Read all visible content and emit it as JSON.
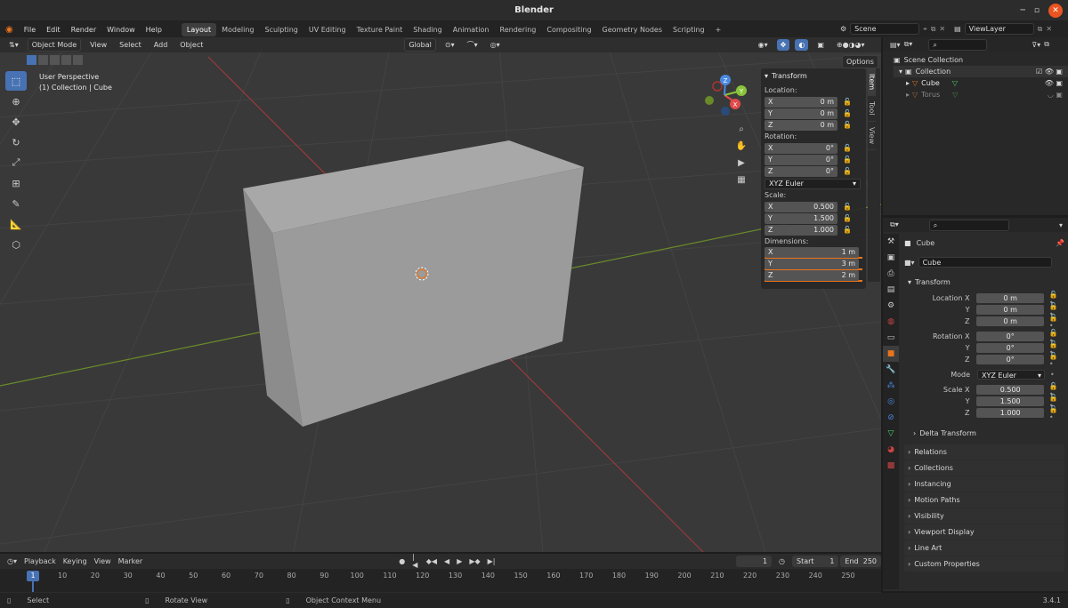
{
  "window": {
    "title": "Blender"
  },
  "topbar": {
    "menus": [
      "File",
      "Edit",
      "Render",
      "Window",
      "Help"
    ],
    "workspaces": [
      "Layout",
      "Modeling",
      "Sculpting",
      "UV Editing",
      "Texture Paint",
      "Shading",
      "Animation",
      "Rendering",
      "Compositing",
      "Geometry Nodes",
      "Scripting"
    ],
    "active_workspace": "Layout",
    "add_tab": "+",
    "scene": "Scene",
    "view_layer": "ViewLayer"
  },
  "viewport": {
    "mode": "Object Mode",
    "menus": [
      "View",
      "Select",
      "Add",
      "Object"
    ],
    "transform_orientation": "Global",
    "options_label": "Options",
    "overlay_title": "User Perspective",
    "overlay_subtitle": "(1) Collection | Cube",
    "gizmo_axes": [
      "X",
      "Y",
      "Z"
    ]
  },
  "npanel": {
    "title": "Transform",
    "location_label": "Location:",
    "location": [
      {
        "axis": "X",
        "value": "0 m"
      },
      {
        "axis": "Y",
        "value": "0 m"
      },
      {
        "axis": "Z",
        "value": "0 m"
      }
    ],
    "rotation_label": "Rotation:",
    "rotation": [
      {
        "axis": "X",
        "value": "0°"
      },
      {
        "axis": "Y",
        "value": "0°"
      },
      {
        "axis": "Z",
        "value": "0°"
      }
    ],
    "rotation_mode": "XYZ Euler",
    "scale_label": "Scale:",
    "scale": [
      {
        "axis": "X",
        "value": "0.500"
      },
      {
        "axis": "Y",
        "value": "1.500"
      },
      {
        "axis": "Z",
        "value": "1.000"
      }
    ],
    "dimensions_label": "Dimensions:",
    "dimensions": [
      {
        "axis": "X",
        "value": "1 m"
      },
      {
        "axis": "Y",
        "value": "3 m"
      },
      {
        "axis": "Z",
        "value": "2 m"
      }
    ],
    "tabs": [
      "Item",
      "Tool",
      "View"
    ],
    "highlight_color": "#e8741c"
  },
  "outliner": {
    "root": "Scene Collection",
    "collection": "Collection",
    "items": [
      "Cube",
      "Torus"
    ]
  },
  "properties": {
    "object_name": "Cube",
    "data_name": "Cube",
    "section": "Transform",
    "location": [
      {
        "label": "Location X",
        "value": "0 m"
      },
      {
        "label": "Y",
        "value": "0 m"
      },
      {
        "label": "Z",
        "value": "0 m"
      }
    ],
    "rotation": [
      {
        "label": "Rotation X",
        "value": "0°"
      },
      {
        "label": "Y",
        "value": "0°"
      },
      {
        "label": "Z",
        "value": "0°"
      }
    ],
    "mode_label": "Mode",
    "mode_value": "XYZ Euler",
    "scale": [
      {
        "label": "Scale X",
        "value": "0.500"
      },
      {
        "label": "Y",
        "value": "1.500"
      },
      {
        "label": "Z",
        "value": "1.000"
      }
    ],
    "delta": "Delta Transform",
    "collapsed": [
      "Relations",
      "Collections",
      "Instancing",
      "Motion Paths",
      "Visibility",
      "Viewport Display",
      "Line Art",
      "Custom Properties"
    ]
  },
  "timeline": {
    "menus": [
      "Playback",
      "Keying",
      "View",
      "Marker"
    ],
    "current_frame": "1",
    "start_label": "Start",
    "start_value": "1",
    "end_label": "End",
    "end_value": "250",
    "ticks": [
      "1",
      "10",
      "20",
      "30",
      "40",
      "50",
      "60",
      "70",
      "80",
      "90",
      "100",
      "110",
      "120",
      "130",
      "140",
      "150",
      "160",
      "170",
      "180",
      "190",
      "200",
      "210",
      "220",
      "230",
      "240",
      "250"
    ]
  },
  "statusbar": {
    "items": [
      "Select",
      "Rotate View",
      "Object Context Menu"
    ],
    "version": "3.4.1"
  }
}
